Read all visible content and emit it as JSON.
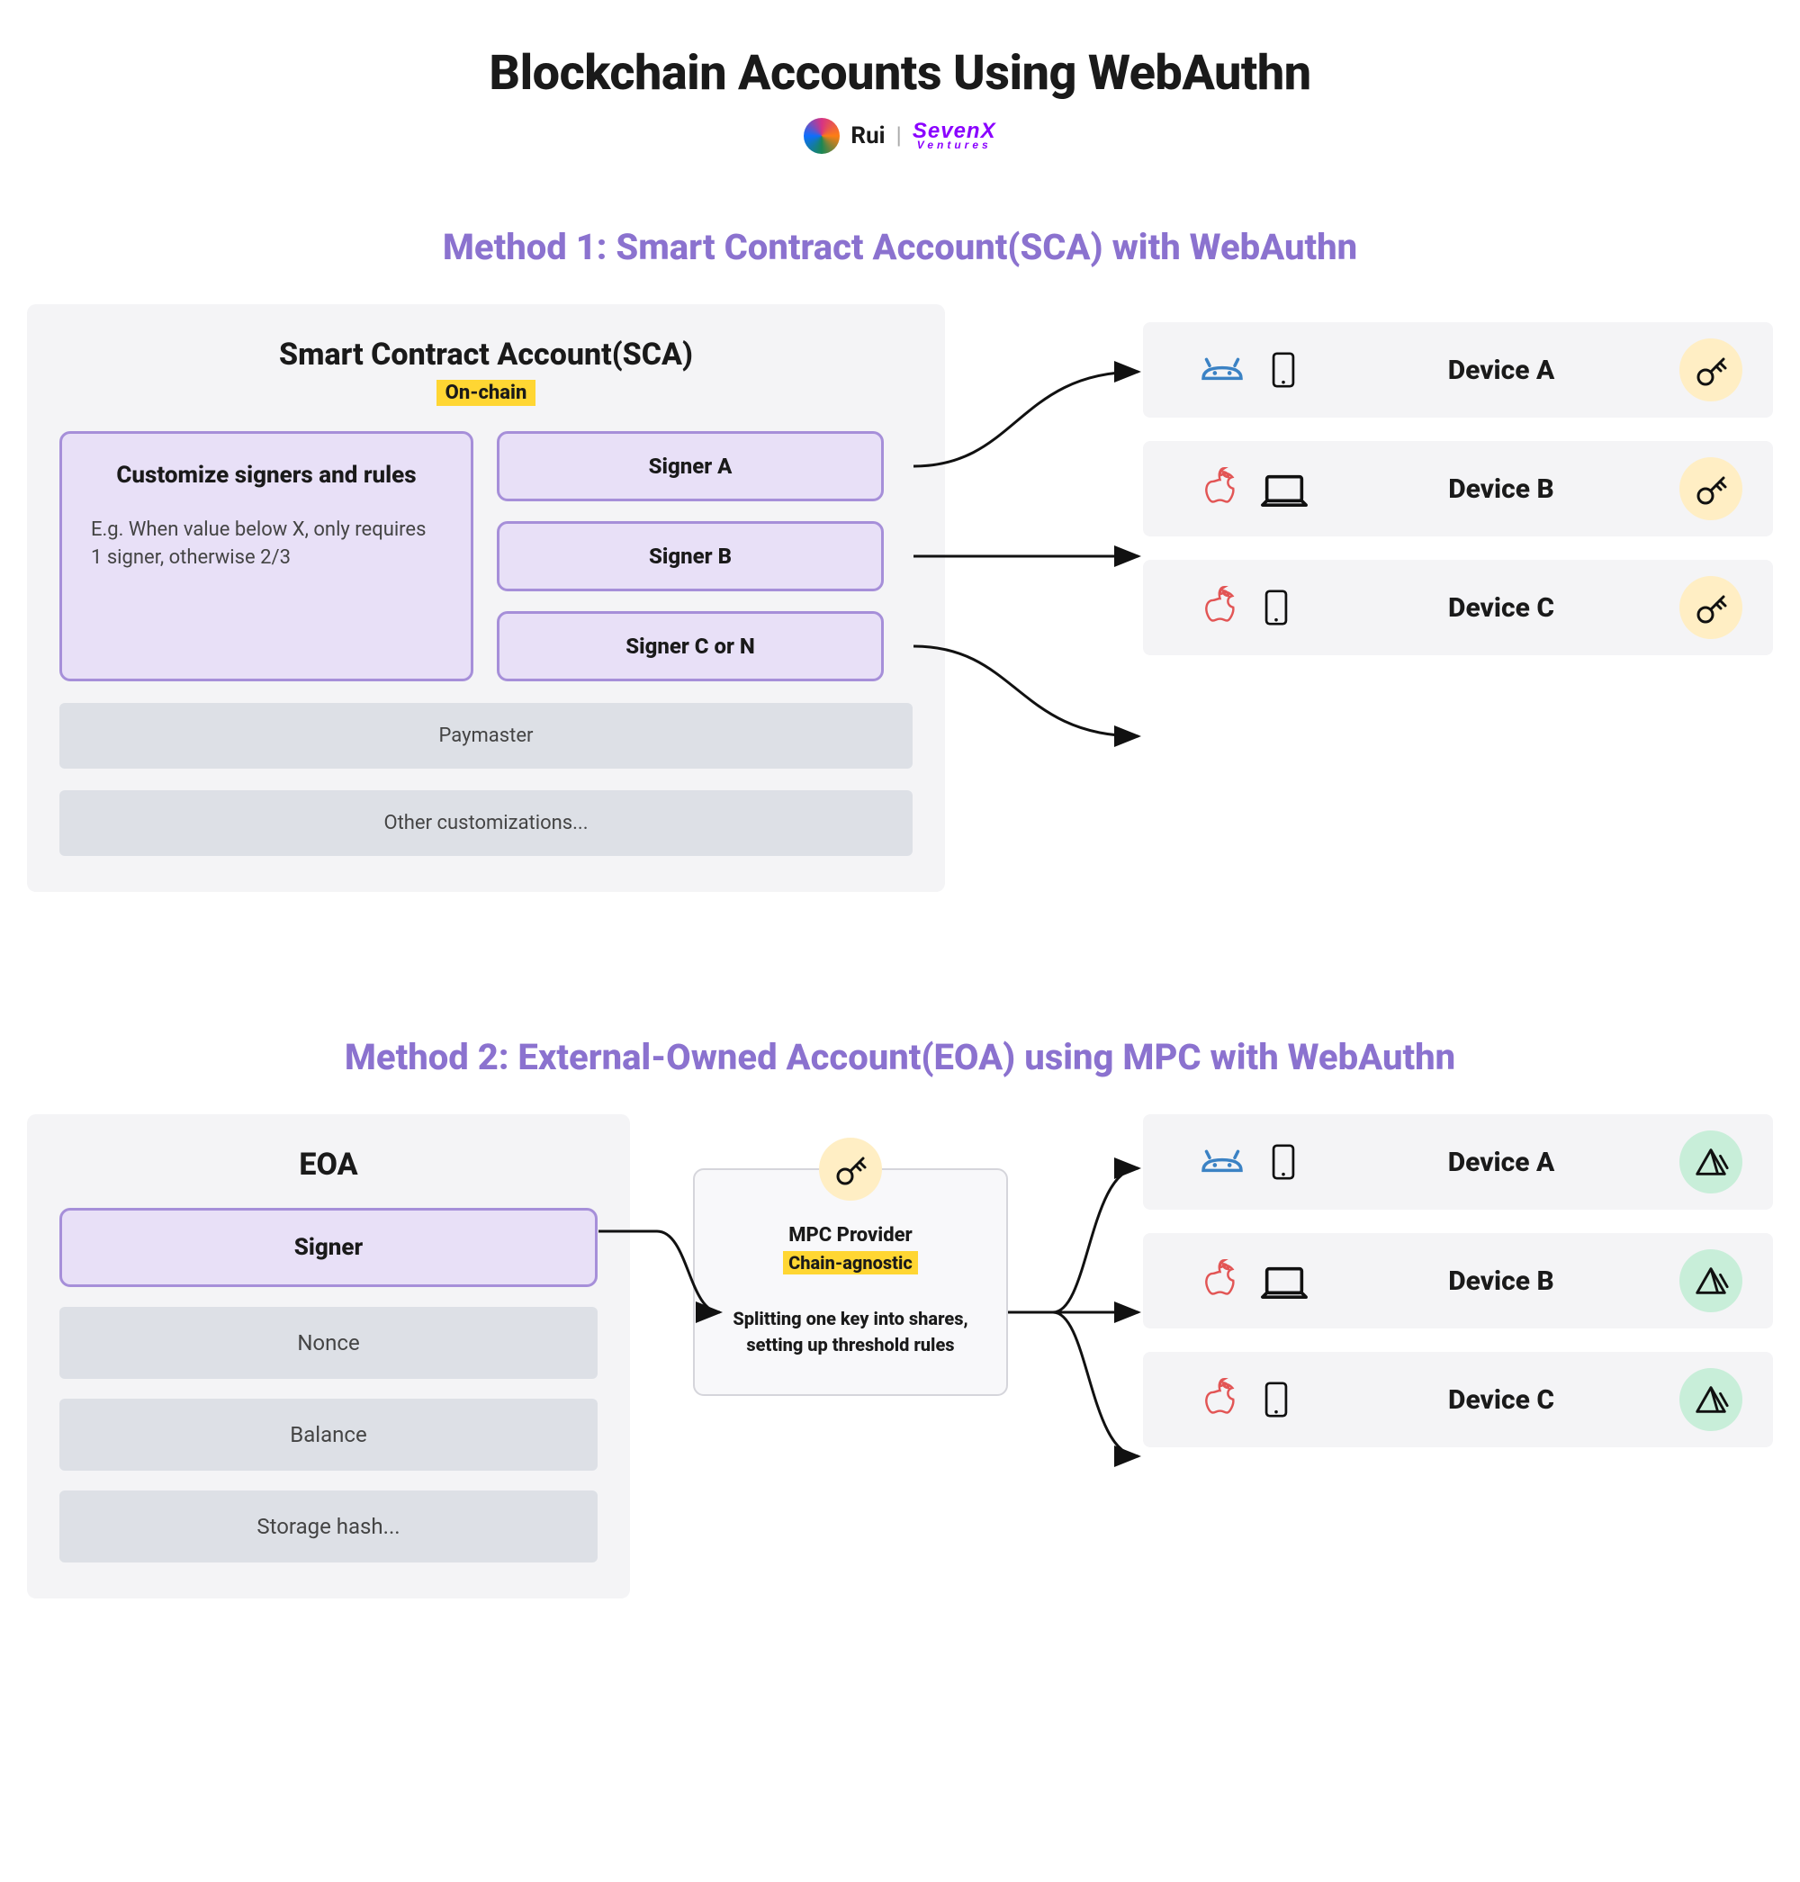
{
  "title": "Blockchain Accounts Using WebAuthn",
  "byline": {
    "author": "Rui",
    "brand_top": "SevenX",
    "brand_sub": "Ventures"
  },
  "method1": {
    "heading": "Method 1: Smart Contract Account(SCA) with WebAuthn",
    "card_title": "Smart Contract Account(SCA)",
    "badge": "On-chain",
    "rules_title": "Customize signers and rules",
    "rules_example": "E.g. When value below X, only requires 1 signer, otherwise 2/3",
    "signers": [
      {
        "label": "Signer A"
      },
      {
        "label": "Signer B"
      },
      {
        "label": "Signer C or N"
      }
    ],
    "extras": [
      {
        "label": "Paymaster"
      },
      {
        "label": "Other customizations..."
      }
    ],
    "devices": [
      {
        "os": "android",
        "device": "phone",
        "label": "Device A",
        "badge": "key"
      },
      {
        "os": "apple",
        "device": "laptop",
        "label": "Device B",
        "badge": "key"
      },
      {
        "os": "apple",
        "device": "phone",
        "label": "Device C",
        "badge": "key"
      }
    ]
  },
  "method2": {
    "heading": "Method 2: External-Owned Account(EOA) using MPC with WebAuthn",
    "card_title": "EOA",
    "signer": "Signer",
    "rows": [
      {
        "label": "Nonce"
      },
      {
        "label": "Balance"
      },
      {
        "label": "Storage hash..."
      }
    ],
    "mpc_title": "MPC Provider",
    "mpc_badge": "Chain-agnostic",
    "mpc_desc": "Splitting one key into shares, setting up threshold rules",
    "devices": [
      {
        "os": "android",
        "device": "phone",
        "label": "Device A",
        "badge": "shard"
      },
      {
        "os": "apple",
        "device": "laptop",
        "label": "Device B",
        "badge": "shard"
      },
      {
        "os": "apple",
        "device": "phone",
        "label": "Device C",
        "badge": "shard"
      }
    ]
  }
}
